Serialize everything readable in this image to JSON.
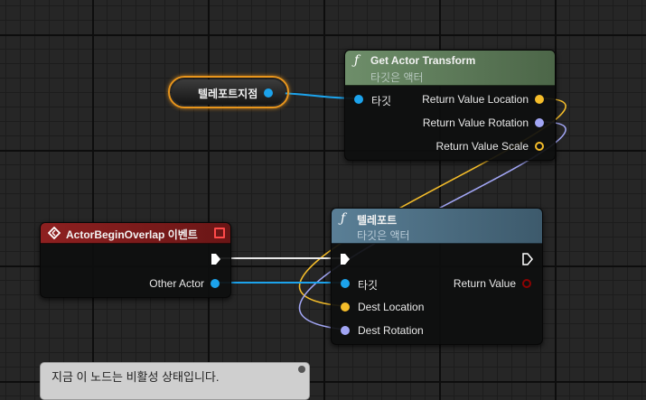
{
  "colors": {
    "object_pin": "#1ca3ec",
    "vector_pin": "#f5bd2a",
    "rotator_pin": "#a2a6f5",
    "transform_pin": "#f5a623",
    "exec_pin": "#ffffff",
    "bool_pin": "#8d0202",
    "event_header": "#7c1c1c",
    "function_header_gat": "#5c7a59",
    "function_header_tp": "#4d6f84"
  },
  "var_node": {
    "label": "텔레포트지점"
  },
  "get_actor_transform": {
    "icon": "function-icon",
    "title": "Get Actor Transform",
    "subtitle": "타깃은 액터",
    "target_label": "타깃",
    "out_location": "Return Value Location",
    "out_rotation": "Return Value Rotation",
    "out_scale": "Return Value Scale"
  },
  "event_node": {
    "icon": "event-diamond-icon",
    "title": "ActorBeginOverlap 이벤트",
    "other_actor": "Other Actor"
  },
  "teleport_node": {
    "icon": "function-icon",
    "title": "텔레포트",
    "subtitle": "타깃은 액터",
    "target_label": "타깃",
    "return_value": "Return Value",
    "dest_location": "Dest Location",
    "dest_rotation": "Dest Rotation"
  },
  "comment": {
    "line1": "지금 이 노드는 비활성 상태입니다."
  }
}
